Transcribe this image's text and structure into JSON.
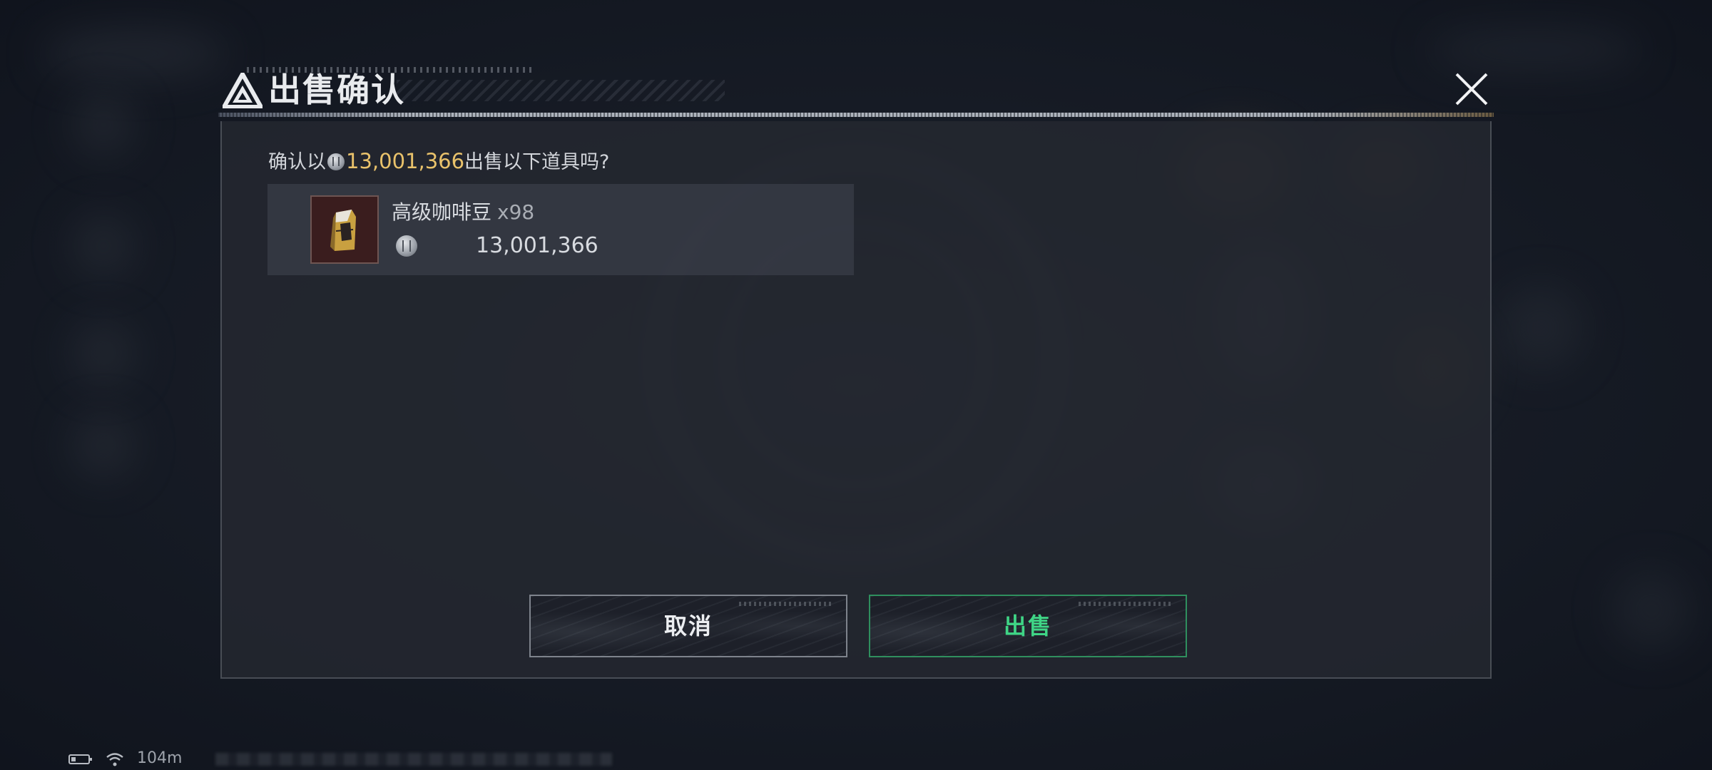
{
  "dialog": {
    "title": "出售确认",
    "confirm_prefix": "确认以",
    "confirm_amount": "13,001,366",
    "confirm_suffix": "出售以下道具吗?"
  },
  "item": {
    "name": "高级咖啡豆",
    "quantity": "x98",
    "price": "13,001,366"
  },
  "buttons": {
    "cancel_label": "取消",
    "sell_label": "出售"
  },
  "status_bar": {
    "ping": "104m"
  },
  "icons": {
    "logo": "triangle-logo-icon",
    "close": "close-icon",
    "coin": "coin-icon",
    "battery": "battery-icon",
    "wifi": "wifi-icon"
  },
  "colors": {
    "amount_highlight": "#e9c26b",
    "sell_accent": "#3fd586",
    "sell_border": "#2f8f5e",
    "cancel_border": "#7e838c"
  }
}
